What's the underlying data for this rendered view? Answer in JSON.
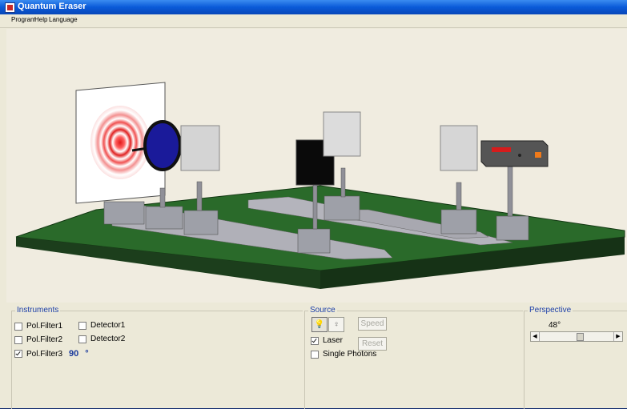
{
  "window": {
    "title": "Quantum Eraser"
  },
  "menu": [
    "Program",
    "Help",
    "Language"
  ],
  "instruments": {
    "title": "Instruments",
    "pol_filter1": {
      "label": "Pol.Filter1",
      "checked": false
    },
    "pol_filter2": {
      "label": "Pol.Filter2",
      "checked": false
    },
    "pol_filter3": {
      "label": "Pol.Filter3",
      "checked": true,
      "angle": "90",
      "unit": "°"
    },
    "detector1": {
      "label": "Detector1",
      "checked": false
    },
    "detector2": {
      "label": "Detector2",
      "checked": false
    }
  },
  "source": {
    "title": "Source",
    "speed_label": "Speed",
    "reset_label": "Reset",
    "laser": {
      "label": "Laser",
      "checked": true
    },
    "single_photons": {
      "label": "Single Photons",
      "checked": false
    }
  },
  "perspective": {
    "title": "Perspective",
    "value_label": "48°",
    "slider_level": 0.55
  }
}
